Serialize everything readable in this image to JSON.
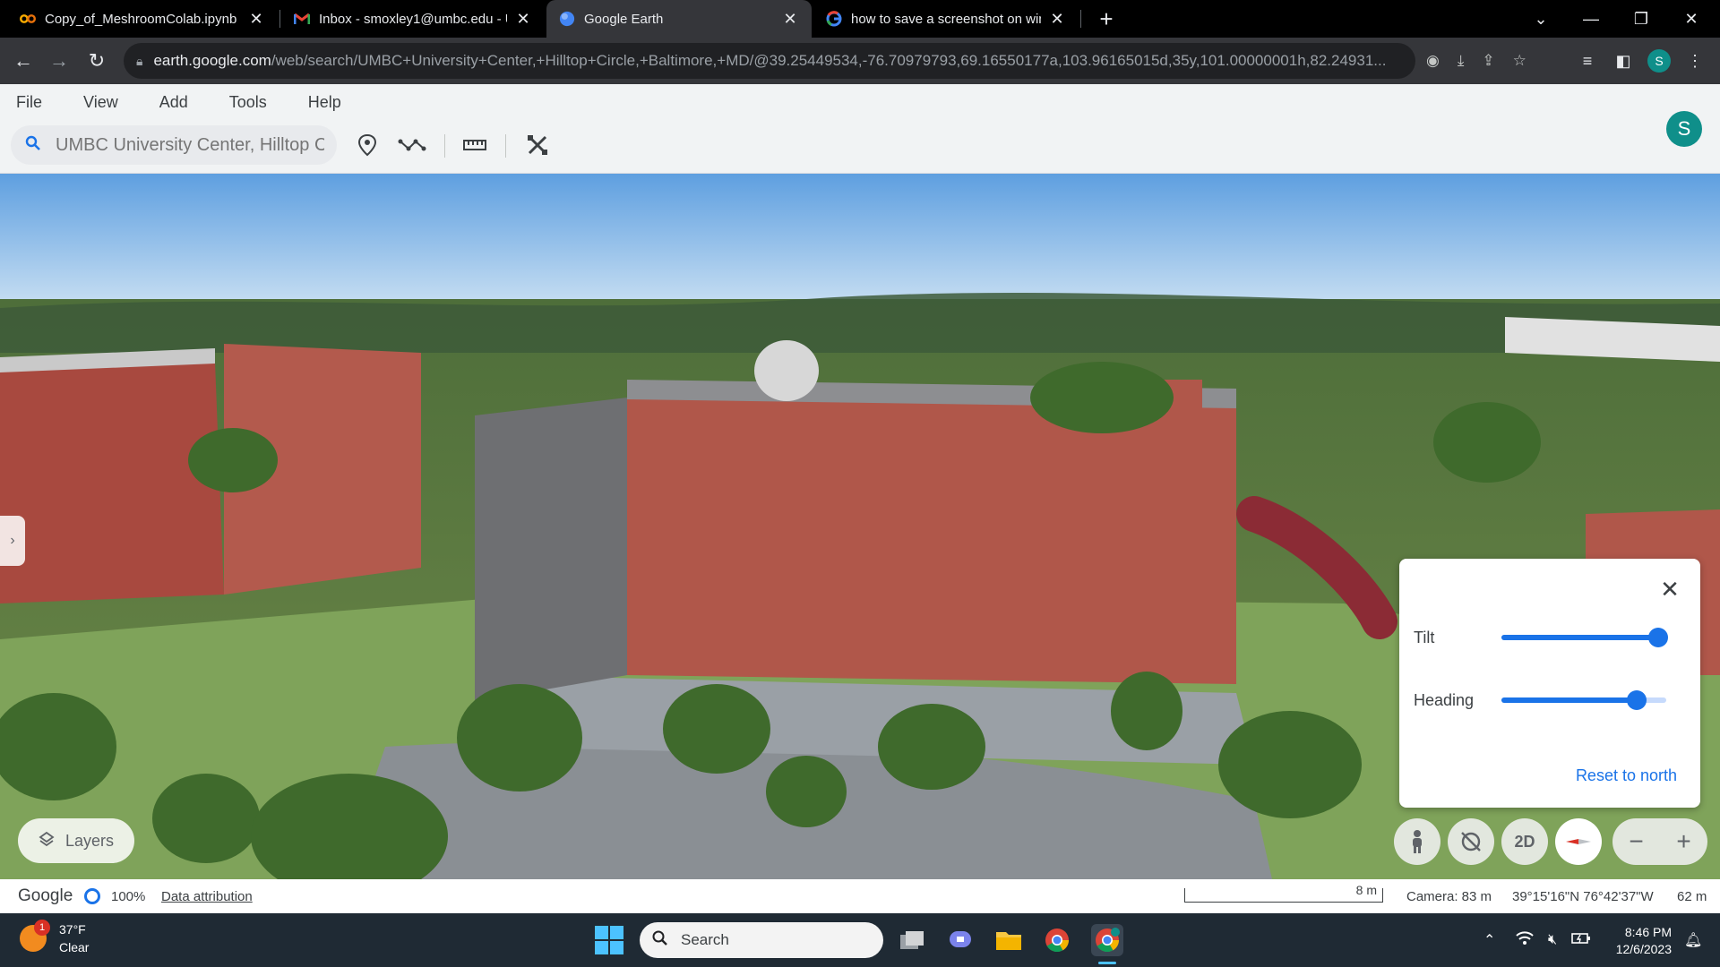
{
  "browser": {
    "tabs": [
      {
        "title": "Copy_of_MeshroomColab.ipynb",
        "favicon": "colab-icon",
        "active": false
      },
      {
        "title": "Inbox - smoxley1@umbc.edu - U",
        "favicon": "gmail-icon",
        "active": false
      },
      {
        "title": "Google Earth",
        "favicon": "earth-icon",
        "active": true
      },
      {
        "title": "how to save a screenshot on win",
        "favicon": "google-icon",
        "active": false
      }
    ],
    "new_tab_label": "+",
    "address": {
      "host": "earth.google.com",
      "path": "/web/search/UMBC+University+Center,+Hilltop+Circle,+Baltimore,+MD/@39.25449534,-76.70979793,69.16550177a,103.96165015d,35y,101.00000001h,82.24931..."
    },
    "profile_initial": "S"
  },
  "earth": {
    "menu": [
      "File",
      "View",
      "Add",
      "Tools",
      "Help"
    ],
    "search": {
      "value": "",
      "placeholder": "UMBC University Center, Hilltop Ci"
    },
    "account_initial": "S",
    "layers_label": "Layers",
    "panel": {
      "tilt_label": "Tilt",
      "heading_label": "Heading",
      "reset_label": "Reset to north",
      "tilt_value": 0.95,
      "heading_value": 0.82
    },
    "controls": {
      "view_2d": "2D"
    },
    "status": {
      "logo": "Google",
      "load_percent": "100%",
      "attribution": "Data attribution",
      "scale": "8 m",
      "camera": "Camera: 83 m",
      "coordinates": "39°15'16\"N 76°42'37\"W",
      "elevation": "62 m"
    },
    "colors": {
      "accent": "#1a73e8",
      "account": "#0f8f8a"
    }
  },
  "taskbar": {
    "weather_temp": "37°F",
    "weather_desc": "Clear",
    "weather_badge": "1",
    "search_label": "Search",
    "time": "8:46 PM",
    "date": "12/6/2023"
  }
}
